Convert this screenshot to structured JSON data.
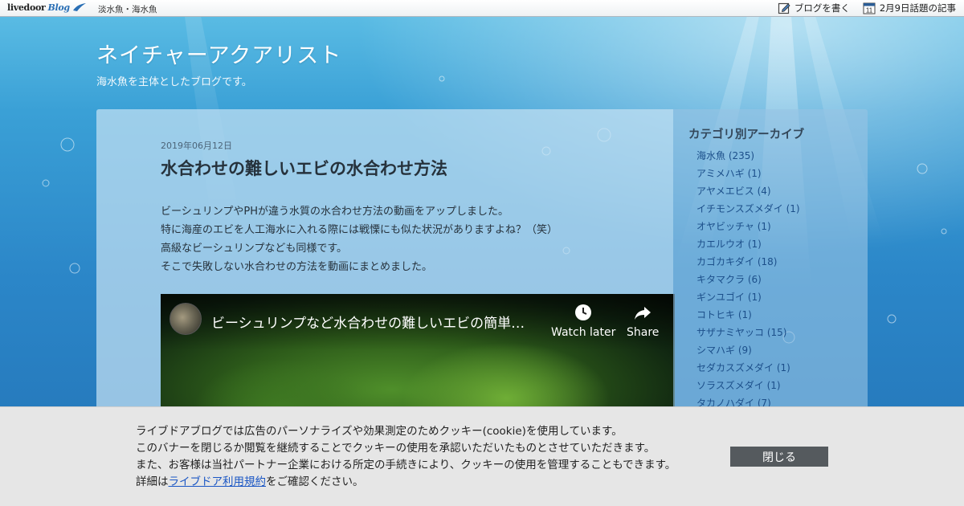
{
  "topbar": {
    "logo_text": "livedoor",
    "logo_blog": "Blog",
    "breadcrumb": "淡水魚・海水魚",
    "write_label": "ブログを書く",
    "calendar_day": "11",
    "trending_label": "2月9日話題の記事"
  },
  "header": {
    "title": "ネイチャーアクアリスト",
    "description": "海水魚を主体としたブログです。"
  },
  "post": {
    "date": "2019年06月12日",
    "title": "水合わせの難しいエビの水合わせ方法",
    "body": [
      "ビーシュリンプやPHが違う水質の水合わせ方法の動画をアップしました。",
      "特に海産のエビを人工海水に入れる際には戦慄にも似た状況がありますよね？（笑）",
      "高級なビーシュリンプなども同様です。",
      "そこで失敗しない水合わせの方法を動画にまとめました。"
    ],
    "video": {
      "title": "ビーシュリンプなど水合わせの難しいエビの簡単…",
      "watch_later": "Watch later",
      "share": "Share"
    }
  },
  "sidebar": {
    "heading": "カテゴリ別アーカイブ",
    "categories": [
      "海水魚 (235)",
      "アミメハギ (1)",
      "アヤメエビス (4)",
      "イチモンスズメダイ (1)",
      "オヤビッチャ (1)",
      "カエルウオ (1)",
      "カゴカキダイ (18)",
      "キタマクラ (6)",
      "ギンユゴイ (1)",
      "コトヒキ (1)",
      "サザナミヤッコ (15)",
      "シマハギ (9)",
      "セダカスズメダイ (1)",
      "ソラスズメダイ (1)",
      "タカノハダイ (7)"
    ]
  },
  "cookie": {
    "line1": "ライブドアブログでは広告のパーソナライズや効果測定のためクッキー(cookie)を使用しています。",
    "line2": "このバナーを閉じるか閲覧を継続することでクッキーの使用を承認いただいたものとさせていただきます。",
    "line3": "また、お客様は当社パートナー企業における所定の手続きにより、クッキーの使用を管理することもできます。",
    "line4_prefix": "詳細は",
    "line4_link": "ライブドア利用規約",
    "line4_suffix": "をご確認ください。",
    "close_label": "閉じる"
  },
  "colors": {
    "link": "#1c4f8a",
    "cookie_button": "#555a5e",
    "accent_blue": "#2a6fb5"
  }
}
